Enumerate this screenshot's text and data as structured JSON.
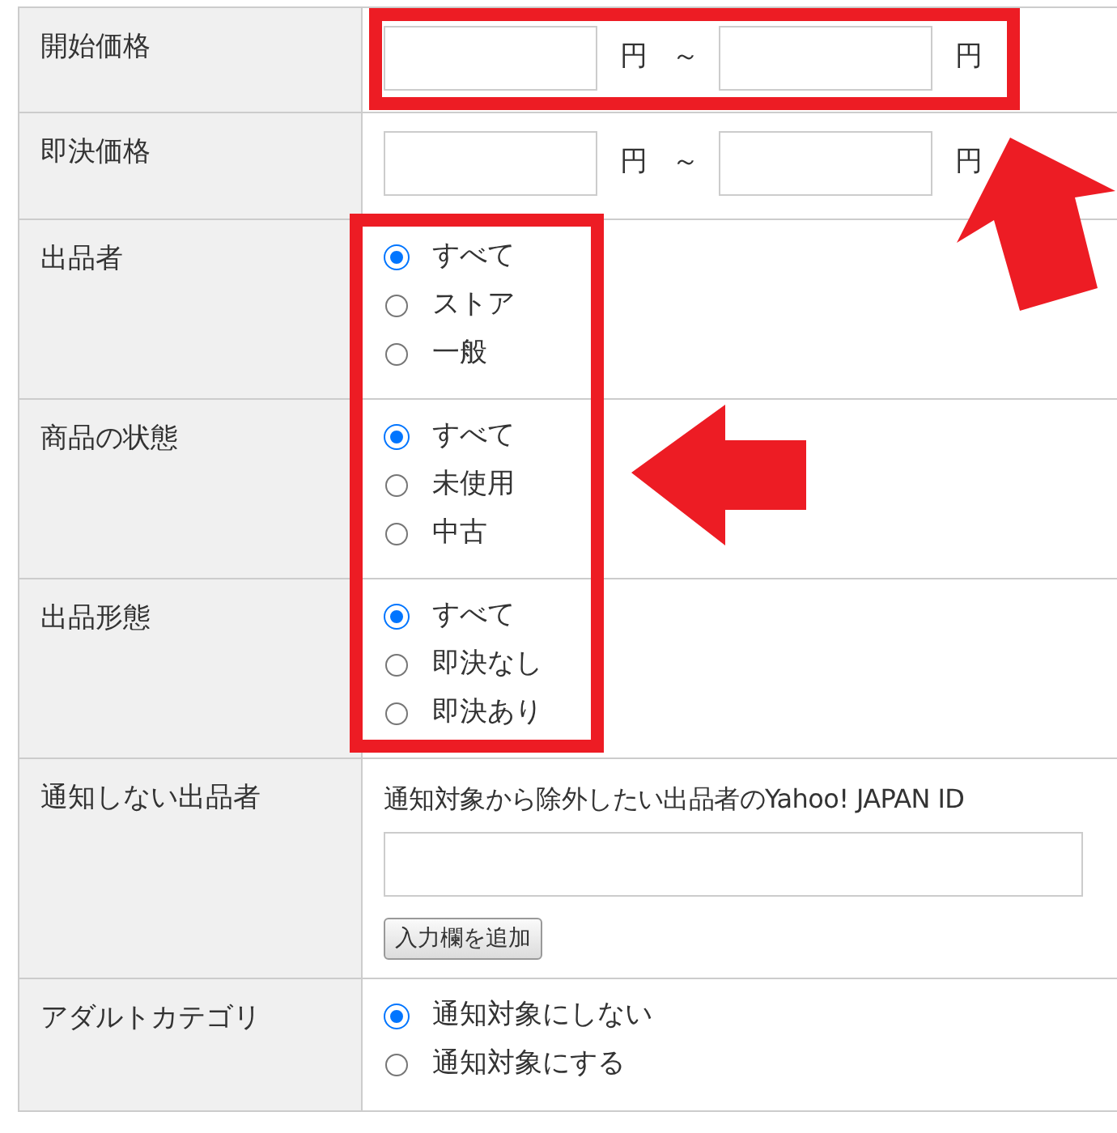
{
  "rows": [
    {
      "kind": "range",
      "label": "開始価格",
      "from_unit": "円",
      "separator": "～",
      "to_unit": "円"
    },
    {
      "kind": "range",
      "label": "即決価格",
      "from_unit": "円",
      "separator": "～",
      "to_unit": "円"
    },
    {
      "kind": "radio",
      "label": "出品者",
      "options": [
        {
          "label": "すべて",
          "selected": true
        },
        {
          "label": "ストア",
          "selected": false
        },
        {
          "label": "一般",
          "selected": false
        }
      ]
    },
    {
      "kind": "radio",
      "label": "商品の状態",
      "options": [
        {
          "label": "すべて",
          "selected": true
        },
        {
          "label": "未使用",
          "selected": false
        },
        {
          "label": "中古",
          "selected": false
        }
      ]
    },
    {
      "kind": "radio",
      "label": "出品形態",
      "options": [
        {
          "label": "すべて",
          "selected": true
        },
        {
          "label": "即決なし",
          "selected": false
        },
        {
          "label": "即決あり",
          "selected": false
        }
      ]
    },
    {
      "kind": "exclude",
      "label": "通知しない出品者",
      "text": "通知対象から除外したい出品者のYahoo! JAPAN ID",
      "button": "入力欄を追加"
    },
    {
      "kind": "radio",
      "label": "アダルトカテゴリ",
      "options": [
        {
          "label": "通知対象にしない",
          "selected": true
        },
        {
          "label": "通知対象にする",
          "selected": false
        }
      ]
    }
  ]
}
